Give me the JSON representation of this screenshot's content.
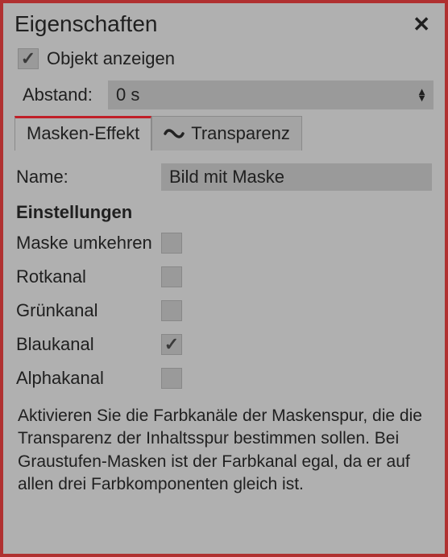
{
  "header": {
    "title": "Eigenschaften"
  },
  "showObject": {
    "label": "Objekt anzeigen",
    "checked": true
  },
  "spacing": {
    "label": "Abstand:",
    "value": "0 s"
  },
  "tabs": {
    "mask": "Masken-Effekt",
    "transparency": "Transparenz"
  },
  "name": {
    "label": "Name:",
    "value": "Bild mit Maske"
  },
  "settings": {
    "heading": "Einstellungen",
    "invert": {
      "label": "Maske umkehren",
      "checked": false
    },
    "red": {
      "label": "Rotkanal",
      "checked": false
    },
    "green": {
      "label": "Grünkanal",
      "checked": false
    },
    "blue": {
      "label": "Blaukanal",
      "checked": true
    },
    "alpha": {
      "label": "Alphakanal",
      "checked": false
    }
  },
  "help": "Aktivieren Sie die Farbkanäle der Maskenspur, die die Transparenz der Inhaltsspur bestimmen sollen. Bei Graustufen-Masken ist der Farbkanal egal, da er auf allen drei Farbkomponenten gleich ist."
}
